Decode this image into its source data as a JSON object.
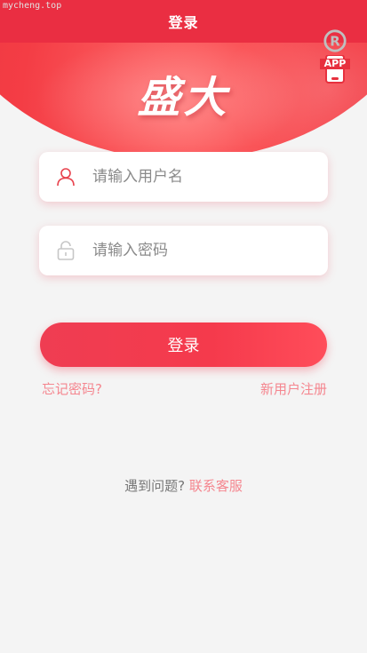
{
  "watermark": "mycheng.top",
  "header": {
    "title": "登录"
  },
  "app_link": {
    "label": "APP"
  },
  "brand": {
    "logo_text": "盛大"
  },
  "form": {
    "username_placeholder": "请输入用户名",
    "password_placeholder": "请输入密码",
    "login_button": "登录"
  },
  "links": {
    "forgot_password": "忘记密码?",
    "register": "新用户注册"
  },
  "help": {
    "question": "遇到问题?",
    "contact": "联系客服"
  },
  "colors": {
    "primary": "#ea2e42",
    "accent_link": "#f5868f",
    "background": "#f4f4f4"
  }
}
